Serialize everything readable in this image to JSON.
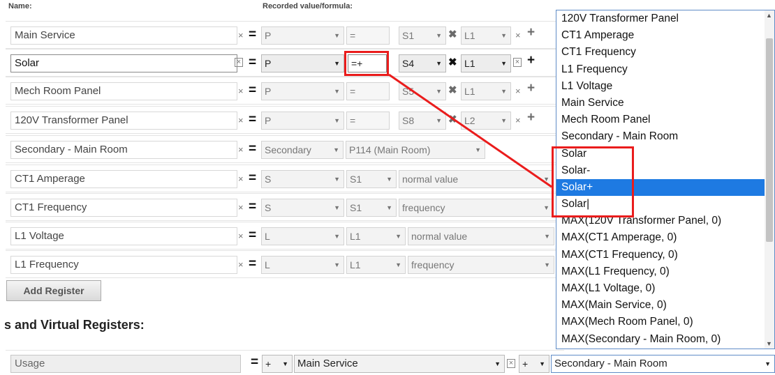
{
  "headers": {
    "name": "Name:",
    "recorded": "Recorded value/formula:"
  },
  "rows": [
    {
      "name": "Main Service",
      "x": "×",
      "eq": "=",
      "type": "P",
      "op": "=",
      "sensor": "S1",
      "mul": "✖",
      "phase": "L1",
      "x2": "×",
      "plus": "+"
    },
    {
      "name": "Solar",
      "x": "×",
      "eq": "=",
      "type": "P",
      "op": "=+",
      "sensor": "S4",
      "mul": "✖",
      "phase": "L1",
      "x2": "×",
      "plus": "+"
    },
    {
      "name": "Mech Room Panel",
      "x": "×",
      "eq": "=",
      "type": "P",
      "op": "=",
      "sensor": "S5",
      "mul": "✖",
      "phase": "L1",
      "x2": "×",
      "plus": "+"
    },
    {
      "name": "120V Transformer Panel",
      "x": "×",
      "eq": "=",
      "type": "P",
      "op": "=",
      "sensor": "S8",
      "mul": "✖",
      "phase": "L2",
      "x2": "×",
      "plus": "+"
    },
    {
      "name": "Secondary - Main Room",
      "x": "×",
      "eq": "=",
      "type": "Secondary",
      "source": "P114 (Main Room)"
    },
    {
      "name": "CT1 Amperage",
      "x": "×",
      "eq": "=",
      "type": "S",
      "sensor": "S1",
      "mode": "normal value"
    },
    {
      "name": "CT1 Frequency",
      "x": "×",
      "eq": "=",
      "type": "S",
      "sensor": "S1",
      "mode": "frequency"
    },
    {
      "name": "L1 Voltage",
      "x": "×",
      "eq": "=",
      "type": "L",
      "sensor": "L1",
      "mode": "normal value"
    },
    {
      "name": "L1 Frequency",
      "x": "×",
      "eq": "=",
      "type": "L",
      "sensor": "L1",
      "mode": "frequency"
    }
  ],
  "add_register_label": "Add Register",
  "section_title": "s and Virtual Registers:",
  "virtual_row": {
    "name": "Usage",
    "eq": "=",
    "op1": "+",
    "register1": "Main Service",
    "x": "×",
    "op2": "+",
    "register2": "Secondary - Main Room"
  },
  "dropdown": {
    "options": [
      "120V Transformer Panel",
      "CT1 Amperage",
      "CT1 Frequency",
      "L1 Frequency",
      "L1 Voltage",
      "Main Service",
      "Mech Room Panel",
      "Secondary - Main Room",
      "Solar",
      "Solar-",
      "Solar+",
      "Solar|",
      "MAX(120V Transformer Panel, 0)",
      "MAX(CT1 Amperage, 0)",
      "MAX(CT1 Frequency, 0)",
      "MAX(L1 Frequency, 0)",
      "MAX(L1 Voltage, 0)",
      "MAX(Main Service, 0)",
      "MAX(Mech Room Panel, 0)",
      "MAX(Secondary - Main Room, 0)"
    ],
    "selected": "Solar+"
  },
  "glyphs": {
    "arrow": "▼",
    "up": "▲",
    "down": "▼"
  },
  "colors": {
    "highlight": "#ea1c1c",
    "selection": "#1e7ae2"
  }
}
